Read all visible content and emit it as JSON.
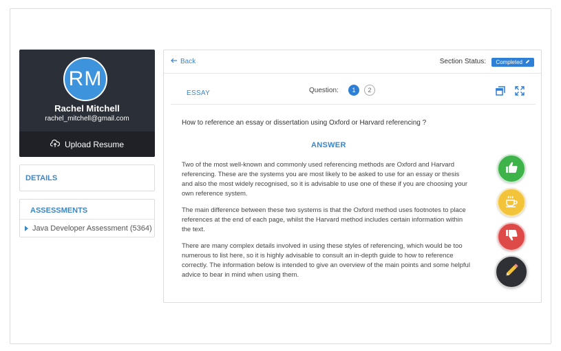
{
  "profile": {
    "initials": "RM",
    "name": "Rachel Mitchell",
    "email": "rachel_mitchell@gmail.com",
    "upload_label": "Upload Resume",
    "upload_icon": "cloud-upload-icon"
  },
  "details": {
    "title": "DETAILS"
  },
  "assessments": {
    "title": "ASSESSMENTS",
    "items": [
      {
        "label": "Java Developer Assessment (5364)"
      }
    ]
  },
  "topbar": {
    "back_label": "Back",
    "section_status_label": "Section Status:",
    "status_badge": "Completed"
  },
  "question_bar": {
    "type_label": "ESSAY",
    "question_label": "Question:",
    "questions": [
      "1",
      "2"
    ],
    "active_question": "1"
  },
  "content": {
    "question": "How to reference an essay or dissertation using Oxford or Harvard referencing ?",
    "answer_heading": "ANSWER",
    "paragraphs": [
      "Two of the most well-known and commonly used referencing methods are Oxford and Harvard referencing. These are the systems you are most likely to be asked to use for an essay or thesis and also the most widely recognised, so it is advisable to use one of these if you are choosing your own reference system.",
      "The main difference between these two systems is that the Oxford method uses footnotes to place references at the end of each page, whilst the Harvard method includes certain information within the text.",
      "There are many complex details involved in using these styles of referencing, which would be too numerous to list here, so it is highly advisable to consult an in-depth guide to how to reference correctly. The information below is intended to give an overview of the main points and some helpful advice to bear in mind when using them."
    ]
  },
  "actions": [
    {
      "name": "thumbs-up-icon",
      "color": "#3db34a"
    },
    {
      "name": "coffee-cup-icon",
      "color": "#f3c33a"
    },
    {
      "name": "thumbs-down-icon",
      "color": "#dd4a48"
    },
    {
      "name": "pencil-icon",
      "color": "#2f3035"
    }
  ],
  "colors": {
    "accent": "#3a86c8",
    "badge": "#2e7fd6",
    "profile_bg": "#2b2f38"
  }
}
